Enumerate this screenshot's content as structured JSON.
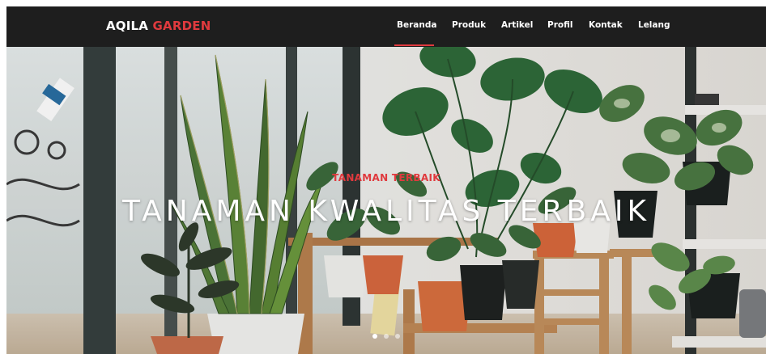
{
  "brand": {
    "first": "AQILA",
    "second": "GARDEN"
  },
  "nav": {
    "items": [
      {
        "label": "Beranda",
        "active": true
      },
      {
        "label": "Produk"
      },
      {
        "label": "Artikel"
      },
      {
        "label": "Profil"
      },
      {
        "label": "Kontak"
      },
      {
        "label": "Lelang"
      }
    ]
  },
  "hero": {
    "kicker": "TANAMAN TERBAIK",
    "headline": "TANAMAN KWALITAS TERBAIK",
    "slides": 3,
    "active_slide": 0
  },
  "colors": {
    "navbar": "#1e1e1e",
    "accent": "#e03a3e",
    "text_light": "#ffffff"
  }
}
